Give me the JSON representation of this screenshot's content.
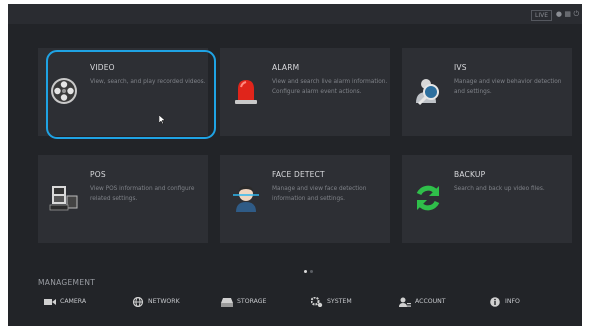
{
  "topbar": {
    "badge": "LIVE",
    "icons": [
      "user-icon",
      "layout-icon",
      "power-icon"
    ]
  },
  "tiles": [
    {
      "title": "VIDEO",
      "desc": "View, search, and play recorded videos.",
      "icon": "film-reel-icon"
    },
    {
      "title": "ALARM",
      "desc": "View and search live alarm information. Configure alarm event actions.",
      "icon": "siren-icon"
    },
    {
      "title": "IVS",
      "desc": "Manage and view behavior detection and settings.",
      "icon": "person-magnifier-icon"
    },
    {
      "title": "POS",
      "desc": "View POS information and configure related settings.",
      "icon": "pos-terminal-icon"
    },
    {
      "title": "FACE DETECT",
      "desc": "Manage and view face detection information and settings.",
      "icon": "face-scan-icon"
    },
    {
      "title": "BACKUP",
      "desc": "Search and back up video files.",
      "icon": "sync-arrows-icon"
    }
  ],
  "pager": {
    "pages": 2,
    "active": 1
  },
  "management": {
    "label": "MANAGEMENT",
    "items": [
      {
        "label": "CAMERA",
        "icon": "camera-icon"
      },
      {
        "label": "NETWORK",
        "icon": "network-globe-icon"
      },
      {
        "label": "STORAGE",
        "icon": "storage-icon"
      },
      {
        "label": "SYSTEM",
        "icon": "gears-icon"
      },
      {
        "label": "ACCOUNT",
        "icon": "account-icon"
      },
      {
        "label": "INFO",
        "icon": "info-icon"
      }
    ]
  },
  "colors": {
    "selection": "#1fa3e4",
    "background": "#222428",
    "tile": "#2d2f34"
  }
}
